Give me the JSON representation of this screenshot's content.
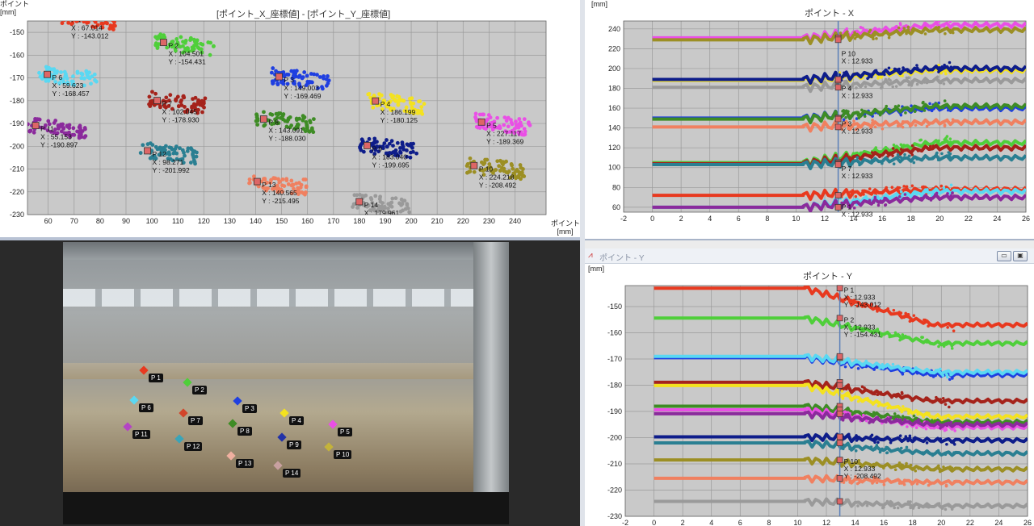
{
  "scatter_window": {
    "title": "[ポイント_X_座標値] - [ポイント_Y_座標値]",
    "ylabel": "ポイント\n[mm]",
    "xlabel": "ポイント\n[mm]",
    "chart_data": {
      "type": "scatter",
      "title": "[ポイント_X_座標値] - [ポイント_Y_座標値]",
      "xlabel": "ポイント [mm]",
      "ylabel": "ポイント [mm]",
      "xlim": [
        52,
        252
      ],
      "ylim": [
        -230,
        -145
      ],
      "x_ticks": [
        60,
        70,
        80,
        90,
        100,
        110,
        120,
        130,
        140,
        150,
        160,
        170,
        180,
        190,
        200,
        210,
        220,
        230,
        240
      ],
      "y_ticks": [
        -150,
        -160,
        -170,
        -180,
        -190,
        -200,
        -210,
        -220,
        -230
      ],
      "grid": true,
      "points": [
        {
          "name": "P 1",
          "x": 67.0,
          "y": -143.012,
          "x_label": "X : 67.014",
          "y_label": "Y : -143.012",
          "color": "#e8391f"
        },
        {
          "name": "P 2",
          "x": 104.501,
          "y": -154.431,
          "x_label": "X : 104.501",
          "y_label": "Y : -154.431",
          "color": "#4fcf3a"
        },
        {
          "name": "P 3",
          "x": 149.0,
          "y": -169.469,
          "x_label": "X : 149.003",
          "y_label": "Y : -169.469",
          "color": "#1f3fe0"
        },
        {
          "name": "P 4",
          "x": 186.199,
          "y": -180.125,
          "x_label": "X : 186.199",
          "y_label": "Y : -180.125",
          "color": "#f4e21f"
        },
        {
          "name": "P 5",
          "x": 227.117,
          "y": -189.369,
          "x_label": "X : 227.117",
          "y_label": "Y : -189.369",
          "color": "#ea4fe6"
        },
        {
          "name": "P 6",
          "x": 59.623,
          "y": -168.457,
          "x_label": "X : 59.623",
          "y_label": "Y : -168.457",
          "color": "#5ad8f2"
        },
        {
          "name": "P 7",
          "x": 102.0,
          "y": -179.9,
          "x_label": "X : 102.045",
          "y_label": "Y : -178.930",
          "color": "#a5231b"
        },
        {
          "name": "P 8",
          "x": 143.091,
          "y": -188.03,
          "x_label": "X : 143.091",
          "y_label": "Y : -188.030",
          "color": "#3e8c25"
        },
        {
          "name": "P 9",
          "x": 183.0,
          "y": -199.695,
          "x_label": "X : 183.040",
          "y_label": "Y : -199.695",
          "color": "#0e1d8a"
        },
        {
          "name": "P 10",
          "x": 224.218,
          "y": -208.492,
          "x_label": "X : 224.218",
          "y_label": "Y : -208.492",
          "color": "#9c8f24"
        },
        {
          "name": "P 11",
          "x": 55.153,
          "y": -190.897,
          "x_label": "X : 55.153",
          "y_label": "Y : -190.897",
          "color": "#8b2a9c"
        },
        {
          "name": "P 12",
          "x": 98.271,
          "y": -201.992,
          "x_label": "X : 98.271",
          "y_label": "Y : -201.992",
          "color": "#2a7f92"
        },
        {
          "name": "P 13",
          "x": 140.565,
          "y": -215.495,
          "x_label": "X : 140.565",
          "y_label": "Y : -215.495",
          "color": "#f08060"
        },
        {
          "name": "P 14",
          "x": 179.961,
          "y": -224.335,
          "x_label": "X : 179.961",
          "y_label": "Y : -224.335",
          "color": "#9a9a9a"
        }
      ]
    }
  },
  "x_window": {
    "title": "ポイント - X",
    "unit": "[mm]",
    "chart_data": {
      "type": "line",
      "title": "ポイント - X",
      "ylabel": "[mm]",
      "xlim": [
        -2,
        26
      ],
      "ylim": [
        55,
        248
      ],
      "x_ticks": [
        -2,
        0,
        2,
        4,
        6,
        8,
        10,
        12,
        14,
        16,
        18,
        20,
        22,
        24,
        26
      ],
      "y_ticks": [
        60,
        80,
        100,
        120,
        140,
        160,
        180,
        200,
        220,
        240
      ],
      "cursor_x": 12.933,
      "series": [
        {
          "name": "P 1",
          "color": "#e8391f",
          "baseline": 72,
          "end": 78
        },
        {
          "name": "P 2",
          "color": "#4fcf3a",
          "baseline": 105,
          "end": 125
        },
        {
          "name": "P 3",
          "color": "#1f3fe0",
          "baseline": 150,
          "end": 160
        },
        {
          "name": "P 4",
          "color": "#f4e21f",
          "baseline": 188,
          "end": 198
        },
        {
          "name": "P 5",
          "color": "#ea4fe6",
          "baseline": 231,
          "end": 244
        },
        {
          "name": "P 6",
          "color": "#5ad8f2",
          "baseline": 60,
          "end": 76
        },
        {
          "name": "P 7",
          "color": "#a5231b",
          "baseline": 104,
          "end": 120
        },
        {
          "name": "P 8",
          "color": "#3e8c25",
          "baseline": 149,
          "end": 162
        },
        {
          "name": "P 9",
          "color": "#0e1d8a",
          "baseline": 189,
          "end": 200
        },
        {
          "name": "P 10",
          "color": "#9c8f24",
          "baseline": 229,
          "end": 239
        },
        {
          "name": "P 11",
          "color": "#8b2a9c",
          "baseline": 60,
          "end": 70
        },
        {
          "name": "P 12",
          "color": "#2a7f92",
          "baseline": 103,
          "end": 110
        },
        {
          "name": "P 13",
          "color": "#f08060",
          "baseline": 141,
          "end": 146
        },
        {
          "name": "P 14",
          "color": "#9a9a9a",
          "baseline": 181,
          "end": 188
        }
      ]
    },
    "labels": [
      {
        "n": "P 10",
        "v": 220
      },
      {
        "n": "P 4",
        "v": 185
      },
      {
        "n": "P 3",
        "v": 149
      },
      {
        "n": "P 7",
        "v": 104
      },
      {
        "n": "P 1",
        "v": 65
      }
    ],
    "cursor_x_text": "X : 12.933"
  },
  "y_window": {
    "window_title": "ポイント - Y",
    "title": "ポイント - Y",
    "unit": "[mm]",
    "minimize": "▭",
    "restore": "▣",
    "chart_data": {
      "type": "line",
      "title": "ポイント - Y",
      "ylabel": "[mm]",
      "xlim": [
        -2,
        26
      ],
      "ylim": [
        -230,
        -142
      ],
      "x_ticks": [
        -2,
        0,
        2,
        4,
        6,
        8,
        10,
        12,
        14,
        16,
        18,
        20,
        22,
        24,
        26
      ],
      "y_ticks": [
        -150,
        -160,
        -170,
        -180,
        -190,
        -200,
        -210,
        -220,
        -230
      ],
      "cursor_x": 12.933,
      "series": [
        {
          "name": "P 1",
          "color": "#e8391f",
          "baseline": -143.0,
          "end": -157
        },
        {
          "name": "P 2",
          "color": "#4fcf3a",
          "baseline": -154.4,
          "end": -164
        },
        {
          "name": "P 3",
          "color": "#1f3fe0",
          "baseline": -169.5,
          "end": -176
        },
        {
          "name": "P 6",
          "color": "#5ad8f2",
          "baseline": -169.0,
          "end": -175
        },
        {
          "name": "P 7",
          "color": "#a5231b",
          "baseline": -178.9,
          "end": -186
        },
        {
          "name": "P 4",
          "color": "#f4e21f",
          "baseline": -180.1,
          "end": -192
        },
        {
          "name": "P 8",
          "color": "#3e8c25",
          "baseline": -188.0,
          "end": -194
        },
        {
          "name": "P 5",
          "color": "#ea4fe6",
          "baseline": -189.4,
          "end": -196
        },
        {
          "name": "P 11",
          "color": "#8b2a9c",
          "baseline": -190.9,
          "end": -195
        },
        {
          "name": "P 9",
          "color": "#0e1d8a",
          "baseline": -199.7,
          "end": -201
        },
        {
          "name": "P 12",
          "color": "#2a7f92",
          "baseline": -202.0,
          "end": -206
        },
        {
          "name": "P 10",
          "color": "#9c8f24",
          "baseline": -208.5,
          "end": -212
        },
        {
          "name": "P 13",
          "color": "#f08060",
          "baseline": -215.5,
          "end": -217
        },
        {
          "name": "P 14",
          "color": "#9a9a9a",
          "baseline": -224.3,
          "end": -226
        }
      ]
    },
    "cursor_labels": [
      {
        "p": "P 1",
        "x": "X : 12.933",
        "y": "Y : -143.012"
      },
      {
        "p": "P 2",
        "x": "X : 12.933",
        "y": "Y : -154.431"
      },
      {
        "p": "P 10",
        "x": "X : 12.933",
        "y": "Y : -208.492"
      }
    ]
  },
  "camera": {
    "markers": [
      {
        "n": "P 1",
        "c": "#e8391f"
      },
      {
        "n": "P 2",
        "c": "#4fcf3a"
      },
      {
        "n": "P 3",
        "c": "#1f3fe0"
      },
      {
        "n": "P 4",
        "c": "#f4e21f"
      },
      {
        "n": "P 5",
        "c": "#ea4fe6"
      },
      {
        "n": "P 6",
        "c": "#5ad8f2"
      },
      {
        "n": "P 7",
        "c": "#d2452a"
      },
      {
        "n": "P 8",
        "c": "#3e8c25"
      },
      {
        "n": "P 9",
        "c": "#2232a8"
      },
      {
        "n": "P 10",
        "c": "#c4b33a"
      },
      {
        "n": "P 11",
        "c": "#b444c4"
      },
      {
        "n": "P 12",
        "c": "#3aa4b8"
      },
      {
        "n": "P 13",
        "c": "#f0b0a0"
      },
      {
        "n": "P 14",
        "c": "#c8a0a0"
      }
    ]
  }
}
